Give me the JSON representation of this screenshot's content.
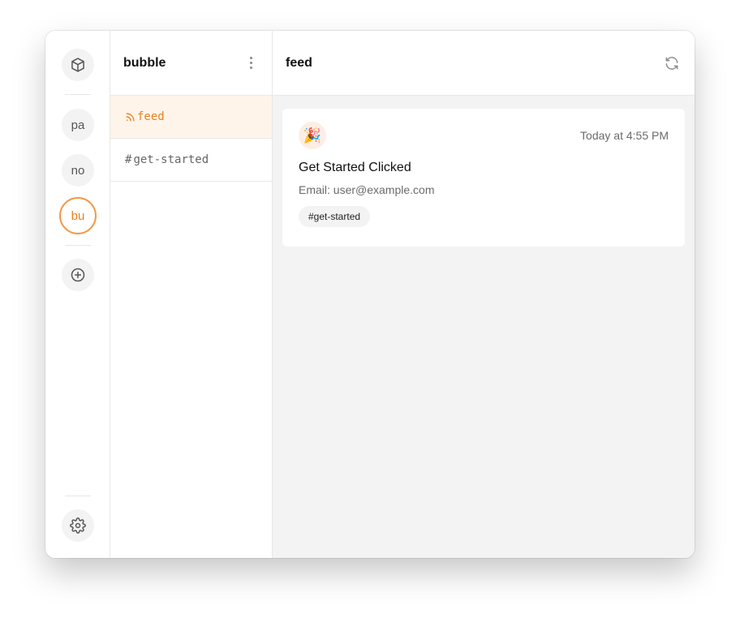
{
  "rail": {
    "top_icon": "box-icon",
    "workspaces": [
      {
        "label": "pa",
        "active": false
      },
      {
        "label": "no",
        "active": false
      },
      {
        "label": "bu",
        "active": true
      }
    ],
    "add_icon": "plus-circle-icon",
    "settings_icon": "gear-icon"
  },
  "sidebar": {
    "title": "bubble",
    "menu_icon": "kebab-icon",
    "channels": [
      {
        "glyph": "rss-icon",
        "label": "feed",
        "active": true
      },
      {
        "glyph": "#",
        "label": "get-started",
        "active": false
      }
    ]
  },
  "main": {
    "title": "feed",
    "refresh_icon": "refresh-icon",
    "events": [
      {
        "emoji": "🎉",
        "time": "Today at 4:55 PM",
        "title": "Get Started Clicked",
        "detail": "Email: user@example.com",
        "tag": "#get-started"
      }
    ]
  },
  "colors": {
    "accent": "#f07d1a",
    "accent_bg": "#fff4ea"
  }
}
